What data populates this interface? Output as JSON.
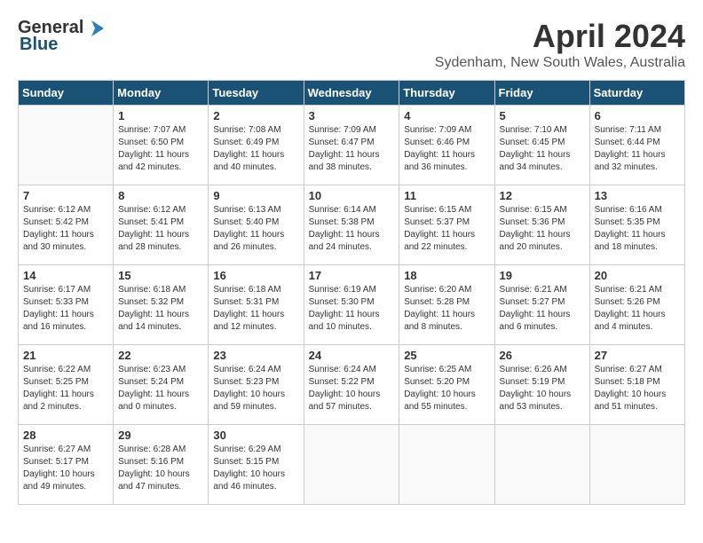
{
  "logo": {
    "general": "General",
    "blue": "Blue"
  },
  "title": "April 2024",
  "location": "Sydenham, New South Wales, Australia",
  "days_of_week": [
    "Sunday",
    "Monday",
    "Tuesday",
    "Wednesday",
    "Thursday",
    "Friday",
    "Saturday"
  ],
  "weeks": [
    [
      {
        "day": "",
        "info": ""
      },
      {
        "day": "1",
        "info": "Sunrise: 7:07 AM\nSunset: 6:50 PM\nDaylight: 11 hours\nand 42 minutes."
      },
      {
        "day": "2",
        "info": "Sunrise: 7:08 AM\nSunset: 6:49 PM\nDaylight: 11 hours\nand 40 minutes."
      },
      {
        "day": "3",
        "info": "Sunrise: 7:09 AM\nSunset: 6:47 PM\nDaylight: 11 hours\nand 38 minutes."
      },
      {
        "day": "4",
        "info": "Sunrise: 7:09 AM\nSunset: 6:46 PM\nDaylight: 11 hours\nand 36 minutes."
      },
      {
        "day": "5",
        "info": "Sunrise: 7:10 AM\nSunset: 6:45 PM\nDaylight: 11 hours\nand 34 minutes."
      },
      {
        "day": "6",
        "info": "Sunrise: 7:11 AM\nSunset: 6:44 PM\nDaylight: 11 hours\nand 32 minutes."
      }
    ],
    [
      {
        "day": "7",
        "info": "Sunrise: 6:12 AM\nSunset: 5:42 PM\nDaylight: 11 hours\nand 30 minutes."
      },
      {
        "day": "8",
        "info": "Sunrise: 6:12 AM\nSunset: 5:41 PM\nDaylight: 11 hours\nand 28 minutes."
      },
      {
        "day": "9",
        "info": "Sunrise: 6:13 AM\nSunset: 5:40 PM\nDaylight: 11 hours\nand 26 minutes."
      },
      {
        "day": "10",
        "info": "Sunrise: 6:14 AM\nSunset: 5:38 PM\nDaylight: 11 hours\nand 24 minutes."
      },
      {
        "day": "11",
        "info": "Sunrise: 6:15 AM\nSunset: 5:37 PM\nDaylight: 11 hours\nand 22 minutes."
      },
      {
        "day": "12",
        "info": "Sunrise: 6:15 AM\nSunset: 5:36 PM\nDaylight: 11 hours\nand 20 minutes."
      },
      {
        "day": "13",
        "info": "Sunrise: 6:16 AM\nSunset: 5:35 PM\nDaylight: 11 hours\nand 18 minutes."
      }
    ],
    [
      {
        "day": "14",
        "info": "Sunrise: 6:17 AM\nSunset: 5:33 PM\nDaylight: 11 hours\nand 16 minutes."
      },
      {
        "day": "15",
        "info": "Sunrise: 6:18 AM\nSunset: 5:32 PM\nDaylight: 11 hours\nand 14 minutes."
      },
      {
        "day": "16",
        "info": "Sunrise: 6:18 AM\nSunset: 5:31 PM\nDaylight: 11 hours\nand 12 minutes."
      },
      {
        "day": "17",
        "info": "Sunrise: 6:19 AM\nSunset: 5:30 PM\nDaylight: 11 hours\nand 10 minutes."
      },
      {
        "day": "18",
        "info": "Sunrise: 6:20 AM\nSunset: 5:28 PM\nDaylight: 11 hours\nand 8 minutes."
      },
      {
        "day": "19",
        "info": "Sunrise: 6:21 AM\nSunset: 5:27 PM\nDaylight: 11 hours\nand 6 minutes."
      },
      {
        "day": "20",
        "info": "Sunrise: 6:21 AM\nSunset: 5:26 PM\nDaylight: 11 hours\nand 4 minutes."
      }
    ],
    [
      {
        "day": "21",
        "info": "Sunrise: 6:22 AM\nSunset: 5:25 PM\nDaylight: 11 hours\nand 2 minutes."
      },
      {
        "day": "22",
        "info": "Sunrise: 6:23 AM\nSunset: 5:24 PM\nDaylight: 11 hours\nand 0 minutes."
      },
      {
        "day": "23",
        "info": "Sunrise: 6:24 AM\nSunset: 5:23 PM\nDaylight: 10 hours\nand 59 minutes."
      },
      {
        "day": "24",
        "info": "Sunrise: 6:24 AM\nSunset: 5:22 PM\nDaylight: 10 hours\nand 57 minutes."
      },
      {
        "day": "25",
        "info": "Sunrise: 6:25 AM\nSunset: 5:20 PM\nDaylight: 10 hours\nand 55 minutes."
      },
      {
        "day": "26",
        "info": "Sunrise: 6:26 AM\nSunset: 5:19 PM\nDaylight: 10 hours\nand 53 minutes."
      },
      {
        "day": "27",
        "info": "Sunrise: 6:27 AM\nSunset: 5:18 PM\nDaylight: 10 hours\nand 51 minutes."
      }
    ],
    [
      {
        "day": "28",
        "info": "Sunrise: 6:27 AM\nSunset: 5:17 PM\nDaylight: 10 hours\nand 49 minutes."
      },
      {
        "day": "29",
        "info": "Sunrise: 6:28 AM\nSunset: 5:16 PM\nDaylight: 10 hours\nand 47 minutes."
      },
      {
        "day": "30",
        "info": "Sunrise: 6:29 AM\nSunset: 5:15 PM\nDaylight: 10 hours\nand 46 minutes."
      },
      {
        "day": "",
        "info": ""
      },
      {
        "day": "",
        "info": ""
      },
      {
        "day": "",
        "info": ""
      },
      {
        "day": "",
        "info": ""
      }
    ]
  ]
}
